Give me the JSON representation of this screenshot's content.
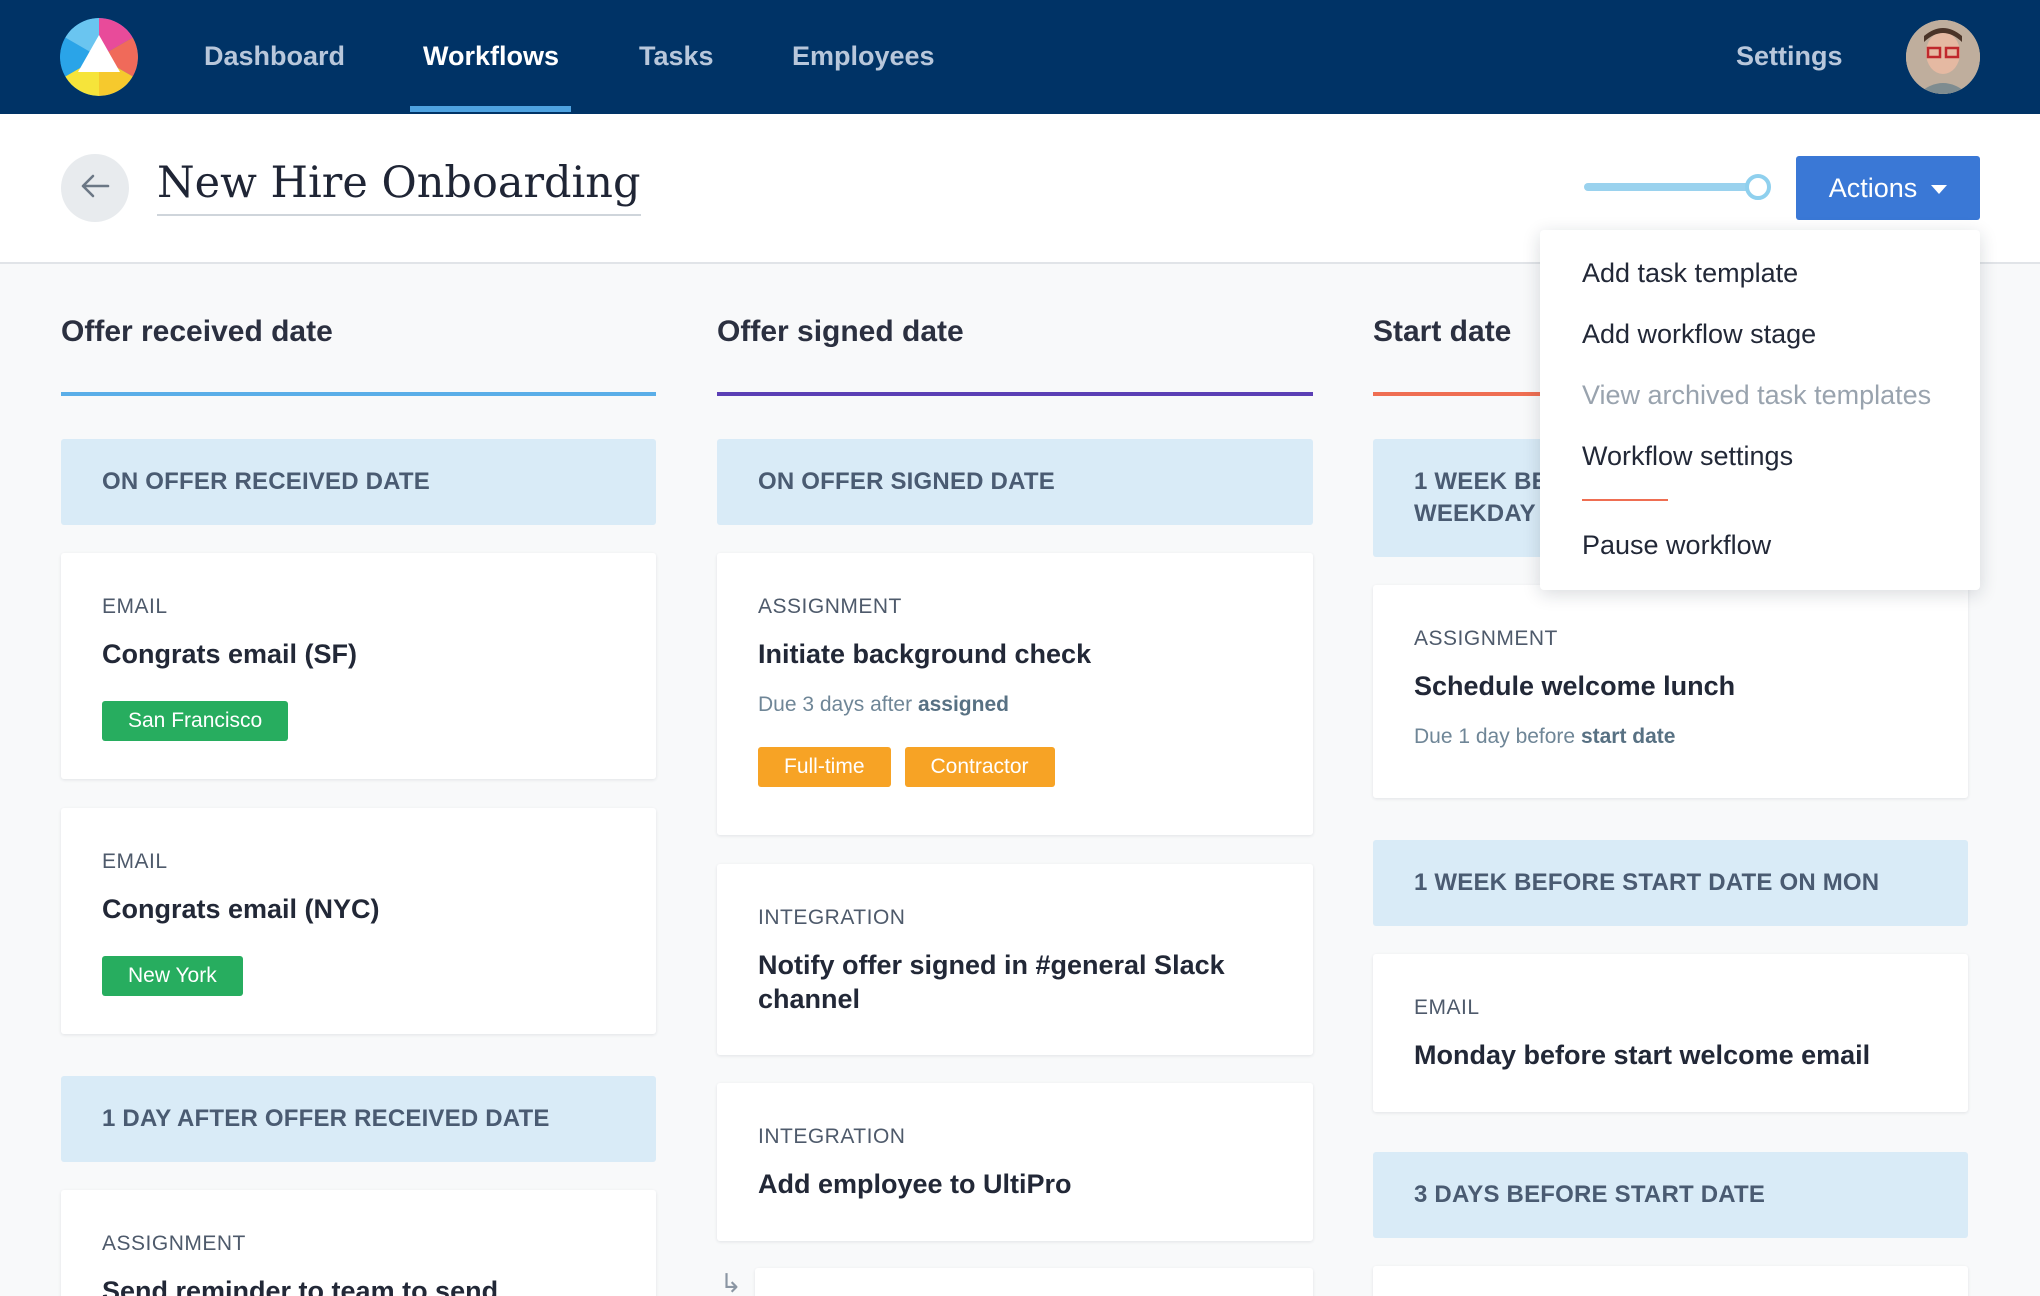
{
  "nav": {
    "items": [
      "Dashboard",
      "Workflows",
      "Tasks",
      "Employees"
    ],
    "active": "Workflows",
    "settings": "Settings",
    "colors": {
      "bg": "#003366",
      "accent": "#4ea2e0"
    }
  },
  "header": {
    "title": "New Hire Onboarding",
    "actions_label": "Actions",
    "back_icon": "arrow-left-icon",
    "toggle_on": true
  },
  "menu": {
    "items": [
      {
        "label": "Add task template",
        "disabled": false
      },
      {
        "label": "Add workflow stage",
        "disabled": false
      },
      {
        "label": "View archived task templates",
        "disabled": true
      },
      {
        "label": "Workflow settings",
        "disabled": false
      },
      {
        "label": "Pause workflow",
        "disabled": false
      }
    ]
  },
  "columns": [
    {
      "title": "Offer received date",
      "color": "#5aaee8",
      "stages": [
        {
          "label": "ON OFFER RECEIVED DATE"
        },
        {
          "label": "1 DAY AFTER OFFER RECEIVED DATE"
        }
      ],
      "cards": [
        {
          "type": "EMAIL",
          "title": "Congrats email (SF)",
          "tags": [
            "San Francisco"
          ]
        },
        {
          "type": "EMAIL",
          "title": "Congrats email (NYC)",
          "tags": [
            "New York"
          ]
        },
        {
          "type": "ASSIGNMENT",
          "title": "Send reminder to team to send"
        }
      ]
    },
    {
      "title": "Offer signed date",
      "color": "#5b3fb5",
      "stages": [
        {
          "label": "ON OFFER SIGNED DATE"
        }
      ],
      "cards": [
        {
          "type": "ASSIGNMENT",
          "title": "Initiate background check",
          "due_prefix": "Due 3 days after",
          "due_ref": "assigned",
          "tags": [
            "Full-time",
            "Contractor"
          ]
        },
        {
          "type": "INTEGRATION",
          "title": "Notify offer signed in #general Slack channel"
        },
        {
          "type": "INTEGRATION",
          "title": "Add employee to UltiPro"
        }
      ]
    },
    {
      "title": "Start date",
      "color": "#ef6e52",
      "stages": [
        {
          "label": "1 WEEK BEFORE START DATE ON WEEKDAY",
          "visible_label": "1 WEEK BE WEEKDAY"
        },
        {
          "label": "1 WEEK BEFORE START DATE ON MON"
        },
        {
          "label": "3 DAYS BEFORE START DATE"
        }
      ],
      "cards": [
        {
          "type": "ASSIGNMENT",
          "title": "Schedule welcome lunch",
          "due_prefix": "Due 1 day before",
          "due_ref": "start date"
        },
        {
          "type": "EMAIL",
          "title": "Monday before start welcome email"
        }
      ]
    }
  ],
  "tag_colors": {
    "location": "#27ad5f",
    "employment": "#f7a325"
  }
}
